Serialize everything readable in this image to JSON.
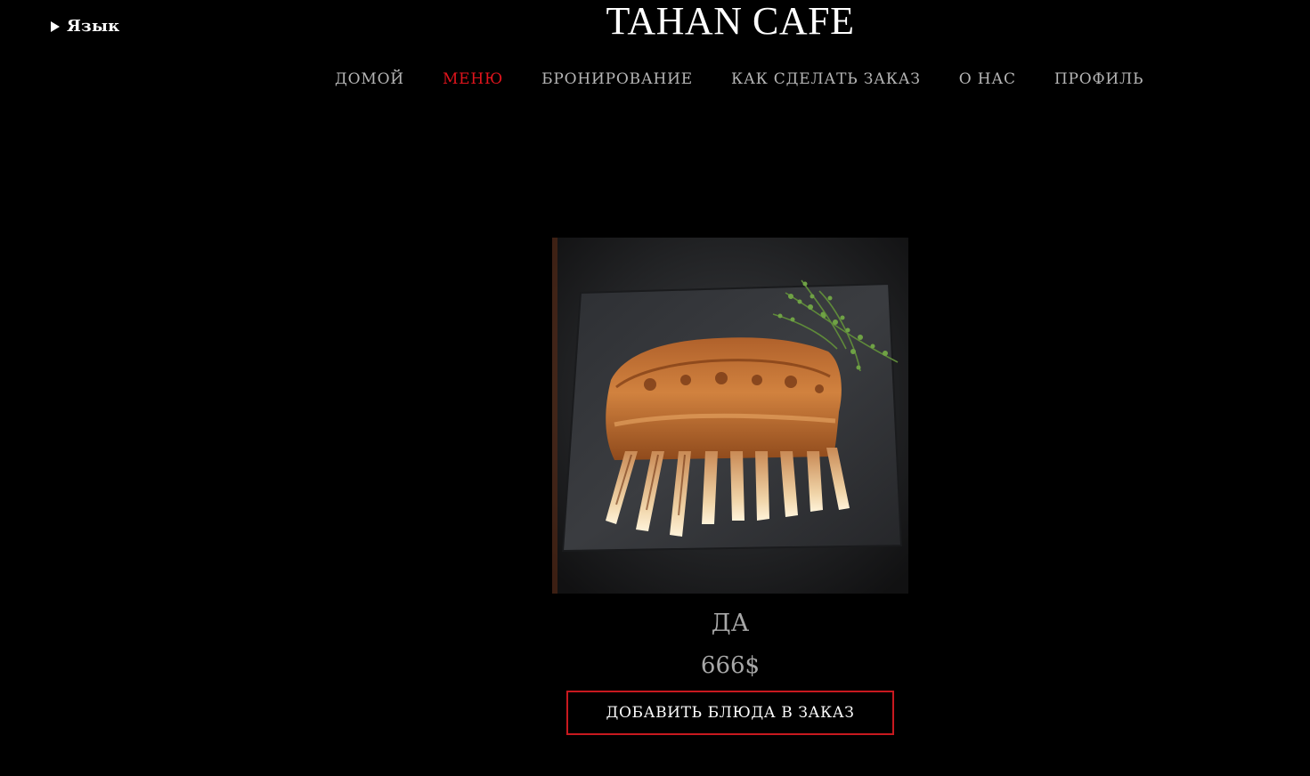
{
  "language": {
    "label": "Язык"
  },
  "brand": {
    "title": "TAHAN CAFE"
  },
  "nav": {
    "items": [
      {
        "label": "ДОМОЙ",
        "active": false
      },
      {
        "label": "МЕНЮ",
        "active": true
      },
      {
        "label": "БРОНИРОВАНИЕ",
        "active": false
      },
      {
        "label": "КАК СДЕЛАТЬ ЗАКАЗ",
        "active": false
      },
      {
        "label": "О НАС",
        "active": false
      },
      {
        "label": "ПРОФИЛЬ",
        "active": false
      }
    ]
  },
  "dish": {
    "name": "ДА",
    "price": "666$",
    "add_button_label": "ДОБАВИТЬ БЛЮДА В ЗАКАЗ"
  },
  "colors": {
    "background": "#000000",
    "accent_red": "#e0141c",
    "button_border": "#c8191f",
    "nav_text": "#b5b5b5",
    "muted_text": "#a8a8a8"
  }
}
